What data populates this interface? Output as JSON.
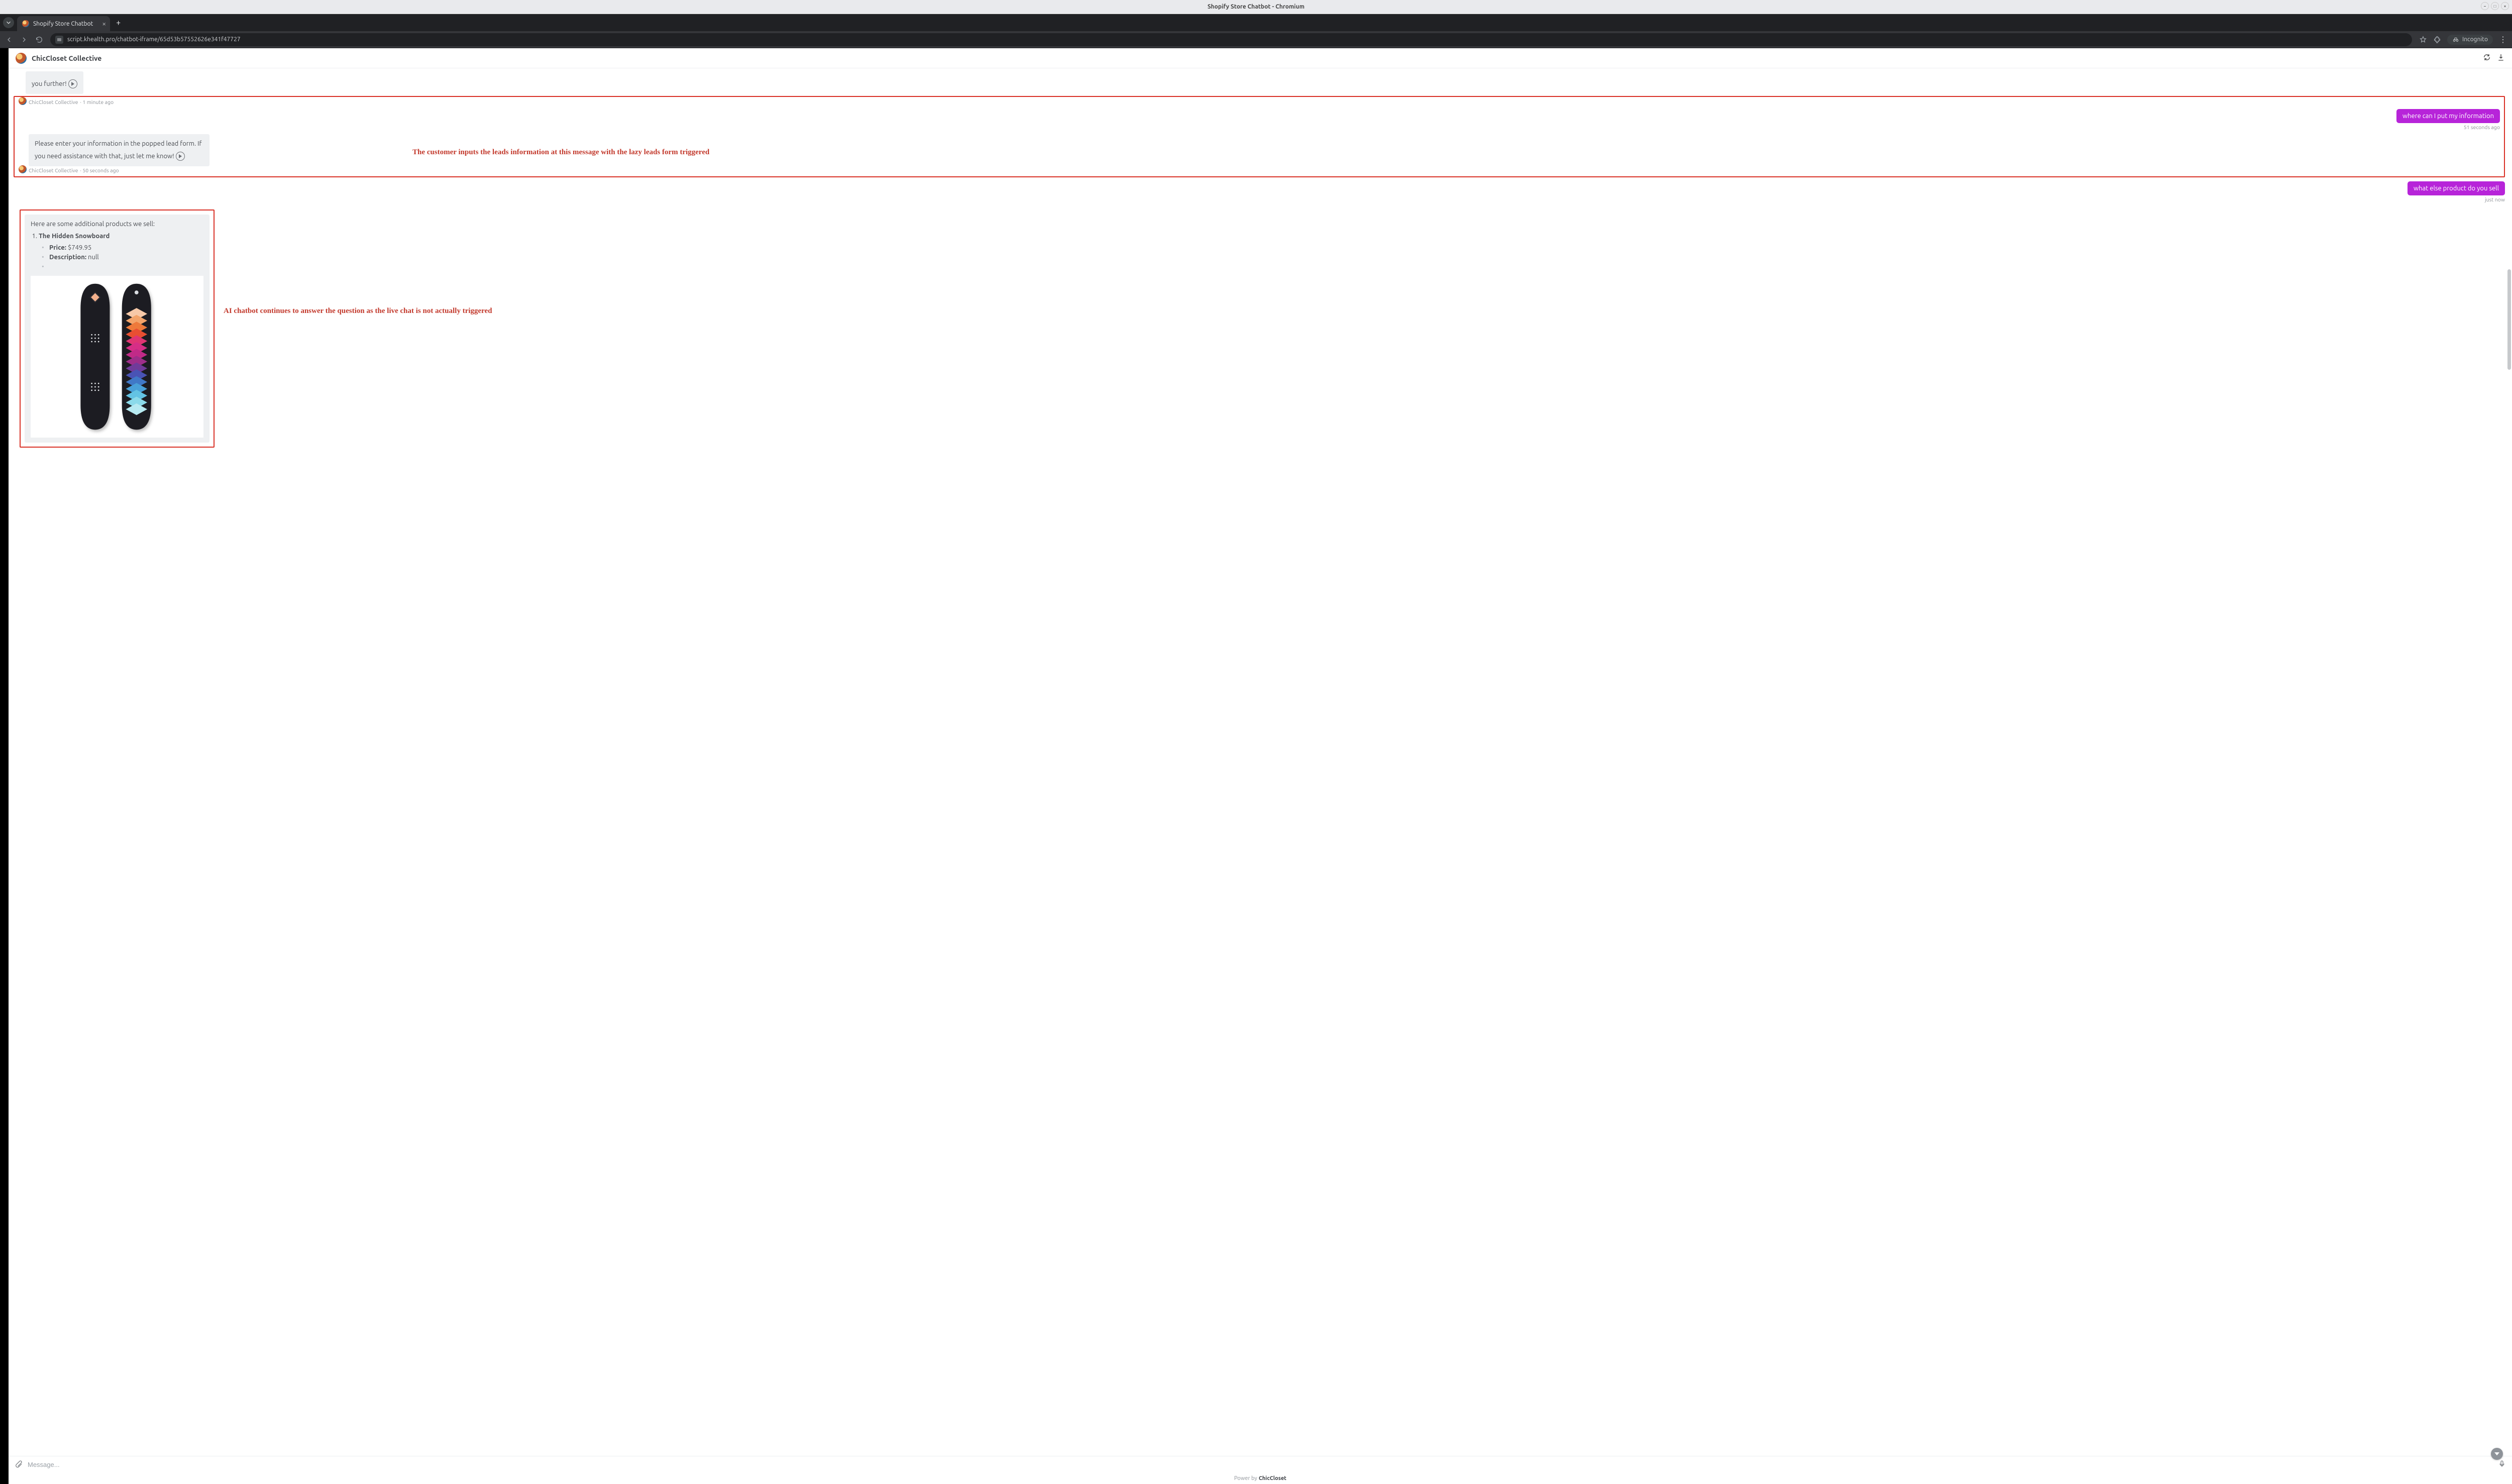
{
  "wm": {
    "title": "Shopify Store Chatbot - Chromium"
  },
  "browser": {
    "tab_title": "Shopify Store Chatbot",
    "url": "script.khealth.pro/chatbot-iframe/65d53b57552626e341f47727",
    "incognito_label": "Incognito"
  },
  "header": {
    "store_name": "ChicCloset Collective"
  },
  "messages": {
    "bot_truncated": {
      "text": "you further!",
      "author": "ChicCloset Collective",
      "time": "· 1 minute ago"
    },
    "user1": {
      "text": "where can I put my information",
      "time": "51 seconds ago"
    },
    "bot_lead": {
      "text": "Please enter your information in the popped lead form. If you need assistance with that, just let me know!",
      "author": "ChicCloset Collective",
      "time": "· 50 seconds ago"
    },
    "user2": {
      "text": "what else product do you sell",
      "time": "just now"
    },
    "bot_products": {
      "intro": "Here are some additional products we sell:",
      "item_name": "The Hidden Snowboard",
      "price_label": "Price:",
      "price_value": "$749.95",
      "desc_label": "Description:",
      "desc_value": "null"
    }
  },
  "annotations": {
    "a1": "The customer inputs the leads information at this message with the lazy leads form triggered",
    "a2": "AI chatbot continues to answer the question as the live chat is not actually triggered"
  },
  "composer": {
    "placeholder": "Message..."
  },
  "footer": {
    "prefix": "Power by",
    "brand": "ChicCloset"
  }
}
